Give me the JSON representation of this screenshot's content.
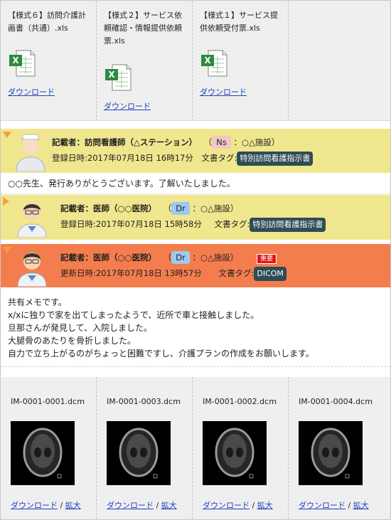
{
  "files": [
    {
      "name": "【様式６】訪問介護計画書（共通）.xls",
      "link": "ダウンロード"
    },
    {
      "name": "【様式２】サービス依頼確認・情報提供依頼票.xls",
      "link": "ダウンロード"
    },
    {
      "name": "【様式１】サービス提供依頼受付票.xls",
      "link": "ダウンロード"
    }
  ],
  "entries": [
    {
      "writer": "記載者：訪問看護師（△ステーション）",
      "role": "Ns",
      "facility": "：○△施設）",
      "open_paren": "（",
      "date_label": "登録日時:",
      "date": "2017年07月18日 16時17分",
      "tag_label": "文書タグ:",
      "tag": "特別訪問看護指示書",
      "body": [
        "○○先生、発行ありがとうございます。了解いたしました。"
      ]
    },
    {
      "writer": "記載者：医師（○○医院）",
      "role": "Dr",
      "facility": "：○△施設）",
      "open_paren": "（",
      "date_label": "登録日時:",
      "date": "2017年07月18日 15時58分",
      "tag_label": "文書タグ:",
      "tag": "特別訪問看護指示書"
    },
    {
      "writer": "記載者：医師（○○医院）",
      "role": "Dr",
      "facility": "：○△施設）",
      "open_paren": "（",
      "urgent": "重要",
      "date_label": "更新日時:",
      "date": "2017年07月18日 13時57分",
      "tag_label": "文書タグ:",
      "tag": "DICOM",
      "body": [
        "共有メモです。",
        "x/xに独りで家を出てしまったようで、近所で車と接触しました。",
        "旦那さんが発見して、入院しました。",
        "大腿骨のあたりを骨折しました。",
        "自力で立ち上がるのがちょっと困難ですし、介護プランの作成をお願いします。"
      ]
    }
  ],
  "dicom": [
    {
      "name": "IM-0001-0001.dcm"
    },
    {
      "name": "IM-0001-0003.dcm"
    },
    {
      "name": "IM-0001-0002.dcm"
    },
    {
      "name": "IM-0001-0004.dcm"
    }
  ],
  "dicom_links": {
    "download": "ダウンロード",
    "sep": " / ",
    "zoom": "拡大"
  }
}
